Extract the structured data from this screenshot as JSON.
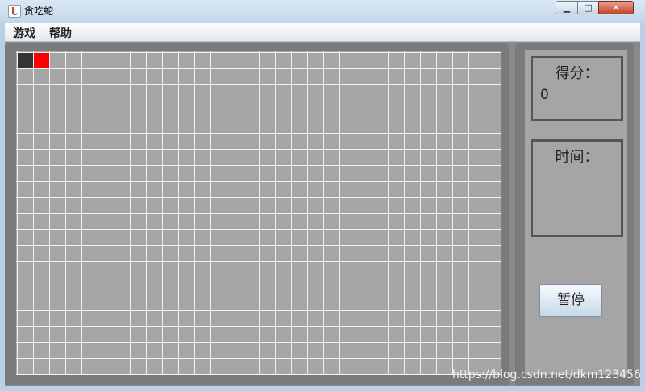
{
  "window": {
    "title": "贪吃蛇"
  },
  "menu": {
    "items": [
      "游戏",
      "帮助"
    ]
  },
  "board": {
    "columns": 30,
    "rows": 20,
    "snake_head_cell": [
      0,
      0
    ],
    "food_cell": [
      1,
      0
    ]
  },
  "panel": {
    "score_label": "得分：",
    "score_value": "0",
    "time_label": "时间：",
    "pause_label": "暂停"
  },
  "watermark": "https://blog.csdn.net/dkm123456",
  "colors": {
    "snake": "#333333",
    "food": "#ff0000",
    "board": "#a5a5a5",
    "grid": "#ffffff"
  }
}
